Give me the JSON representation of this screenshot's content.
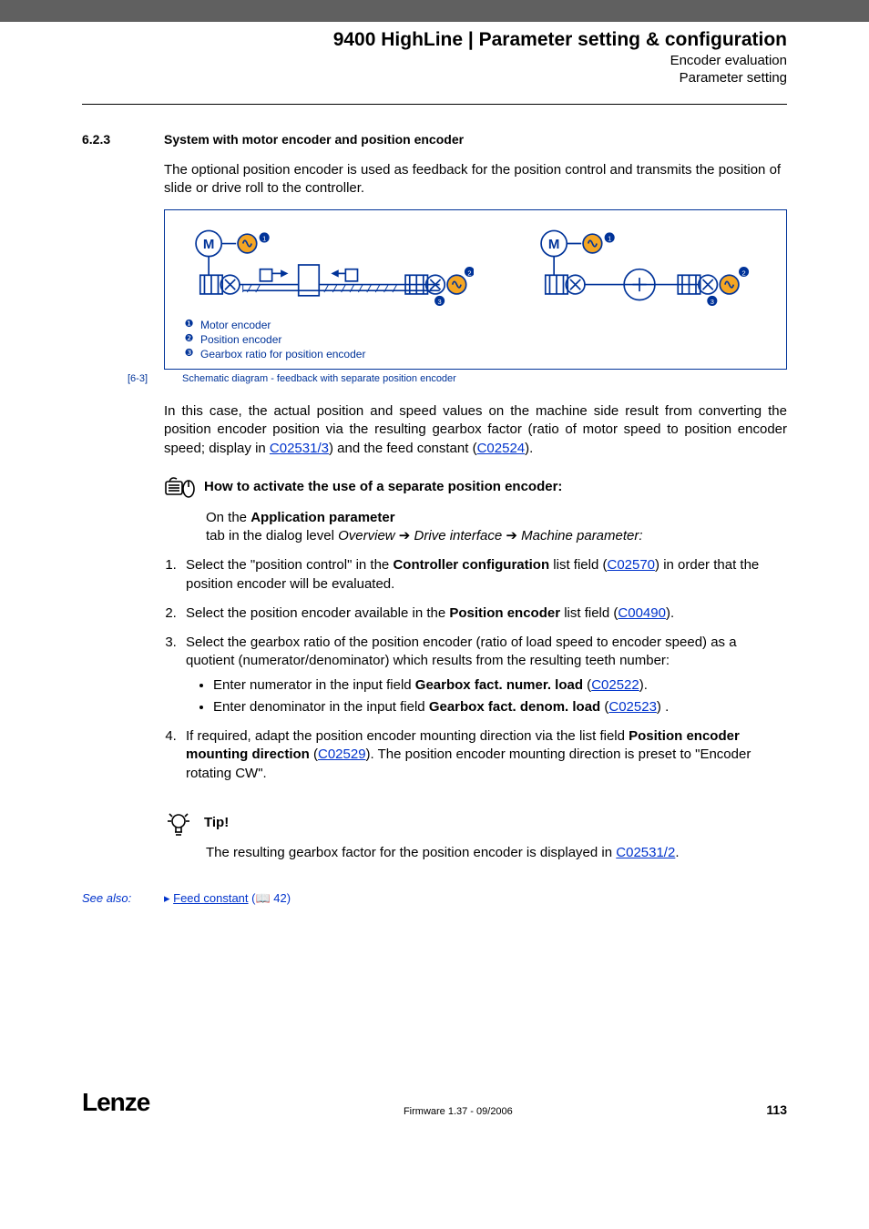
{
  "header": {
    "title": "9400 HighLine | Parameter setting & configuration",
    "sub1": "Encoder evaluation",
    "sub2": "Parameter setting"
  },
  "section": {
    "number": "6.2.3",
    "title": "System with motor encoder and position encoder"
  },
  "intro": "The optional position encoder is used as feedback for the position control and transmits the position of slide or drive roll to the controller.",
  "legend": {
    "l1": "Motor encoder",
    "l2": "Position encoder",
    "l3": "Gearbox ratio for position encoder"
  },
  "figcap": {
    "num": "[6-3]",
    "text": "Schematic diagram - feedback with separate position encoder"
  },
  "para2_pre": "In this case, the actual position and speed values on the machine side result from converting the position encoder position via the resulting gearbox factor (ratio of motor speed to position encoder speed; display in ",
  "para2_link1": "C02531/3",
  "para2_mid": ") and the feed constant (",
  "para2_link2": "C02524",
  "para2_end": ").",
  "howto": {
    "title": "How to activate the use of a separate position encoder:",
    "on_the": "On the ",
    "app_param": "Application parameter",
    "tab_line_a": " tab in the dialog level ",
    "overview": "Overview",
    "drive_if": "Drive interface",
    "mach_param": "Machine parameter:"
  },
  "steps": {
    "s1_a": "Select the \"position control\" in the ",
    "s1_b": "Controller configuration",
    "s1_c": " list field (",
    "s1_link": "C02570",
    "s1_d": ") in order that the position encoder will be evaluated.",
    "s2_a": "Select the position encoder available in the ",
    "s2_b": "Position encoder",
    "s2_c": " list field (",
    "s2_link": "C00490",
    "s2_d": ").",
    "s3_a": "Select the gearbox ratio of the position encoder (ratio of load speed to encoder speed) as a quotient (numerator/denominator) which results from the resulting teeth number:",
    "s3_b1_a": "Enter numerator in the input field ",
    "s3_b1_b": "Gearbox fact. numer. load",
    "s3_b1_c": " (",
    "s3_b1_link": "C02522",
    "s3_b1_d": ").",
    "s3_b2_a": "Enter denominator in the input field ",
    "s3_b2_b": "Gearbox fact. denom. load",
    "s3_b2_c": " (",
    "s3_b2_link": "C02523",
    "s3_b2_d": ") .",
    "s4_a": "If required, adapt the position encoder mounting direction via the list field ",
    "s4_b": "Position encoder mounting direction",
    "s4_c": " (",
    "s4_link": "C02529",
    "s4_d": "). The position encoder mounting direction is preset to \"Encoder rotating CW\"."
  },
  "tip": {
    "label": "Tip!",
    "body_a": "The resulting gearbox factor for the position encoder is displayed in ",
    "body_link": "C02531/2",
    "body_b": "."
  },
  "seealso": {
    "label": "See also:",
    "arrow": "▸ ",
    "link": "Feed constant",
    "page": " (📖 42)"
  },
  "footer": {
    "logo": "Lenze",
    "firmware": "Firmware 1.37 - 09/2006",
    "page": "113"
  }
}
